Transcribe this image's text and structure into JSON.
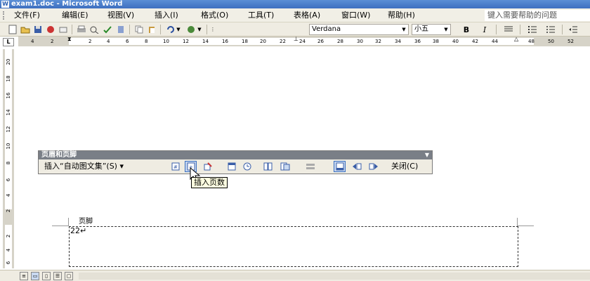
{
  "window": {
    "title": "exam1.doc - Microsoft Word",
    "icon": "word-icon"
  },
  "menu": {
    "items": [
      "文件(F)",
      "编辑(E)",
      "视图(V)",
      "插入(I)",
      "格式(O)",
      "工具(T)",
      "表格(A)",
      "窗口(W)",
      "帮助(H)"
    ],
    "help_placeholder": "键入需要帮助的问题"
  },
  "toolbar": {
    "font_name": "Verdana",
    "font_size": "小五",
    "bold": "B",
    "italic": "I"
  },
  "ruler": {
    "tab_marker": "L",
    "h_ticks": [
      "4",
      "2",
      "2",
      "4",
      "6",
      "8",
      "10",
      "12",
      "14",
      "16",
      "18",
      "20",
      "22",
      "24",
      "26",
      "28",
      "30",
      "32",
      "34",
      "36",
      "38",
      "40",
      "42",
      "44",
      "48",
      "50",
      "52"
    ],
    "v_ticks": [
      "20",
      "18",
      "16",
      "14",
      "12",
      "10",
      "8",
      "6",
      "4",
      "2",
      "2",
      "4",
      "6",
      "8",
      "10",
      "12",
      "14"
    ]
  },
  "header_footer_toolbar": {
    "title": "页眉和页脚",
    "insert_autotext": "插入“自动图文集”(S)",
    "close": "关闭(C)",
    "tooltip": "插入页数"
  },
  "footer": {
    "label": "页脚",
    "text": "22↵"
  },
  "colors": {
    "titlebar": "#3e6fbf",
    "toolbar_bg": "#efece2",
    "tooltip_bg": "#ffffe1",
    "active_button": "#c8d8f0"
  }
}
